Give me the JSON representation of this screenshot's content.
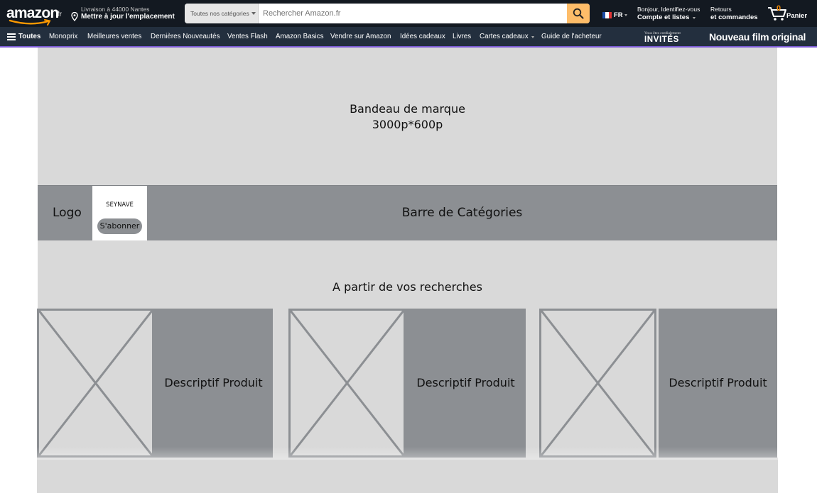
{
  "header": {
    "logo_text": "amazon",
    "logo_tld": ".fr",
    "delivery_line1": "Livraison à 44000 Nantes",
    "delivery_line2": "Mettre à jour l'emplacement",
    "search_category": "Toutes nos catégories",
    "search_placeholder": "Rechercher Amazon.fr",
    "language": "FR",
    "account_line1": "Bonjour, Identifiez-vous",
    "account_line2": "Compte et listes",
    "returns_line1": "Retours",
    "returns_line2": "et commandes",
    "cart_count": "0",
    "cart_label": "Panier"
  },
  "subnav": {
    "all_label": "Toutes",
    "items": [
      "Monoprix",
      "Meilleures ventes",
      "Dernières Nouveautés",
      "Ventes Flash",
      "Amazon Basics",
      "Vendre sur Amazon",
      "Idées cadeaux",
      "Livres",
      "Cartes cadeaux",
      "Guide de l'acheteur"
    ],
    "promo1_small": "Vous êtes cordialement",
    "promo1_big": "INVITÉS",
    "promo2": "Nouveau film original"
  },
  "wireframe": {
    "banner_line1": "Bandeau de marque",
    "banner_line2": "3000p*600p",
    "logo_placeholder": "Logo",
    "brand_name": "SEYNAVE",
    "subscribe_label": "S'abonner",
    "category_bar": "Barre de Catégories",
    "section_title": "A partir de vos recherches",
    "products": [
      {
        "description": "Descriptif Produit"
      },
      {
        "description": "Descriptif Produit"
      },
      {
        "description": "Descriptif Produit"
      }
    ]
  },
  "colors": {
    "nav_dark": "#131921",
    "nav_secondary": "#232f3e",
    "search_button": "#febd69",
    "accent_orange": "#f08804",
    "wireframe_light": "#d9d9d9",
    "wireframe_dark": "#8c8f93"
  },
  "icons": [
    "location-pin-icon",
    "search-icon",
    "france-flag-icon",
    "cart-icon",
    "hamburger-menu-icon",
    "image-placeholder-icon"
  ]
}
